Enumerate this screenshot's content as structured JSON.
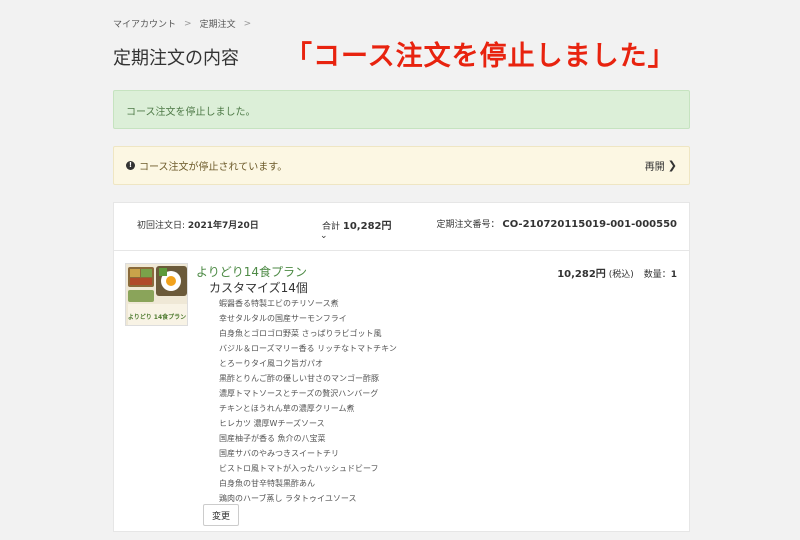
{
  "breadcrumb": {
    "items": [
      "マイアカウント",
      "定期注文"
    ],
    "separator": ">"
  },
  "page_title": "定期注文の内容",
  "caption": "「コース注文を停止しました」",
  "alert_success": "コース注文を停止しました。",
  "alert_warning": {
    "message": "コース注文が停止されています。",
    "resume_label": "再開"
  },
  "order": {
    "first_order_label": "初回注文日:",
    "first_order_date": "2021年7月20日",
    "total_label": "合計",
    "total_amount": "10,282円",
    "number_label": "定期注文番号：",
    "number": "CO-210720115019-001-000550"
  },
  "product": {
    "name": "よりどり14食プラン",
    "customize_title": "カスタマイズ14個",
    "price": "10,282円",
    "tax_note": "(税込)",
    "qty_label": "数量：",
    "qty": "1",
    "image_text": "よりどり 14食プラン",
    "dishes": [
      "蝦醤香る特製エビのチリソース煮",
      "幸せタルタルの国産サーモンフライ",
      "白身魚とゴロゴロ野菜 さっぱりラビゴット風",
      "バジル＆ローズマリー香る リッチなトマトチキン",
      "とろーりタイ風コク旨ガパオ",
      "黒酢とりんご酢の優しい甘さのマンゴー酢豚",
      "濃厚トマトソースとチーズの贅沢ハンバーグ",
      "チキンとほうれん草の濃厚クリーム煮",
      "ヒレカツ 濃厚Wチーズソース",
      "国産柚子が香る 魚介の八宝菜",
      "国産サバのやみつきスイートチリ",
      "ビストロ風トマトが入ったハッシュドビーフ",
      "白身魚の甘辛特製黒酢あん",
      "鶏肉のハーブ蒸し ラタトゥイユソース"
    ],
    "change_label": "変更"
  },
  "colors": {
    "success_bg": "#dcefd8",
    "warning_bg": "#fcf7e3",
    "accent_red": "#e8230f",
    "product_green": "#4d8a45"
  }
}
